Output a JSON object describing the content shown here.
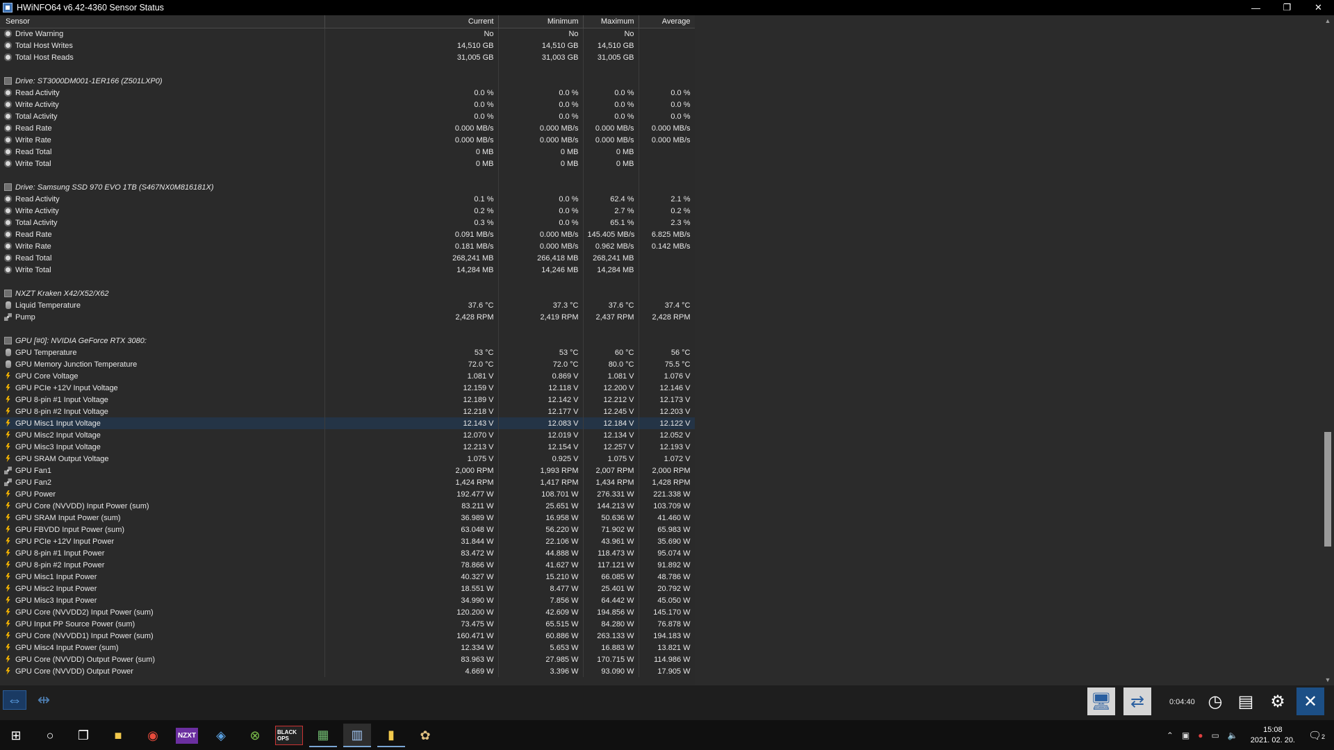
{
  "window": {
    "title": "HWiNFO64 v6.42-4360 Sensor Status",
    "min": "—",
    "restore": "❐",
    "close": "✕"
  },
  "columns": [
    "Sensor",
    "Current",
    "Minimum",
    "Maximum",
    "Average"
  ],
  "rows": [
    {
      "kind": "sensor",
      "icon": "ck",
      "name": "Drive Warning",
      "cur": "No",
      "min": "No",
      "max": "No",
      "avg": ""
    },
    {
      "kind": "sensor",
      "icon": "ck",
      "name": "Total Host Writes",
      "cur": "14,510 GB",
      "min": "14,510 GB",
      "max": "14,510 GB",
      "avg": ""
    },
    {
      "kind": "sensor",
      "icon": "ck",
      "name": "Total Host Reads",
      "cur": "31,005 GB",
      "min": "31,003 GB",
      "max": "31,005 GB",
      "avg": ""
    },
    {
      "kind": "blank"
    },
    {
      "kind": "group",
      "name": "Drive: ST3000DM001-1ER166 (Z501LXP0)"
    },
    {
      "kind": "sensor",
      "icon": "ck",
      "name": "Read Activity",
      "cur": "0.0 %",
      "min": "0.0 %",
      "max": "0.0 %",
      "avg": "0.0 %"
    },
    {
      "kind": "sensor",
      "icon": "ck",
      "name": "Write Activity",
      "cur": "0.0 %",
      "min": "0.0 %",
      "max": "0.0 %",
      "avg": "0.0 %"
    },
    {
      "kind": "sensor",
      "icon": "ck",
      "name": "Total Activity",
      "cur": "0.0 %",
      "min": "0.0 %",
      "max": "0.0 %",
      "avg": "0.0 %"
    },
    {
      "kind": "sensor",
      "icon": "ck",
      "name": "Read Rate",
      "cur": "0.000 MB/s",
      "min": "0.000 MB/s",
      "max": "0.000 MB/s",
      "avg": "0.000 MB/s"
    },
    {
      "kind": "sensor",
      "icon": "ck",
      "name": "Write Rate",
      "cur": "0.000 MB/s",
      "min": "0.000 MB/s",
      "max": "0.000 MB/s",
      "avg": "0.000 MB/s"
    },
    {
      "kind": "sensor",
      "icon": "ck",
      "name": "Read Total",
      "cur": "0 MB",
      "min": "0 MB",
      "max": "0 MB",
      "avg": ""
    },
    {
      "kind": "sensor",
      "icon": "ck",
      "name": "Write Total",
      "cur": "0 MB",
      "min": "0 MB",
      "max": "0 MB",
      "avg": ""
    },
    {
      "kind": "blank"
    },
    {
      "kind": "group",
      "name": "Drive: Samsung SSD 970 EVO 1TB (S467NX0M816181X)"
    },
    {
      "kind": "sensor",
      "icon": "ck",
      "name": "Read Activity",
      "cur": "0.1 %",
      "min": "0.0 %",
      "max": "62.4 %",
      "avg": "2.1 %"
    },
    {
      "kind": "sensor",
      "icon": "ck",
      "name": "Write Activity",
      "cur": "0.2 %",
      "min": "0.0 %",
      "max": "2.7 %",
      "avg": "0.2 %"
    },
    {
      "kind": "sensor",
      "icon": "ck",
      "name": "Total Activity",
      "cur": "0.3 %",
      "min": "0.0 %",
      "max": "65.1 %",
      "avg": "2.3 %"
    },
    {
      "kind": "sensor",
      "icon": "ck",
      "name": "Read Rate",
      "cur": "0.091 MB/s",
      "min": "0.000 MB/s",
      "max": "145.405 MB/s",
      "avg": "6.825 MB/s"
    },
    {
      "kind": "sensor",
      "icon": "ck",
      "name": "Write Rate",
      "cur": "0.181 MB/s",
      "min": "0.000 MB/s",
      "max": "0.962 MB/s",
      "avg": "0.142 MB/s"
    },
    {
      "kind": "sensor",
      "icon": "ck",
      "name": "Read Total",
      "cur": "268,241 MB",
      "min": "266,418 MB",
      "max": "268,241 MB",
      "avg": ""
    },
    {
      "kind": "sensor",
      "icon": "ck",
      "name": "Write Total",
      "cur": "14,284 MB",
      "min": "14,246 MB",
      "max": "14,284 MB",
      "avg": ""
    },
    {
      "kind": "blank"
    },
    {
      "kind": "group",
      "name": "NXZT Kraken X42/X52/X62"
    },
    {
      "kind": "sensor",
      "icon": "th",
      "name": "Liquid Temperature",
      "cur": "37.6 °C",
      "min": "37.3 °C",
      "max": "37.6 °C",
      "avg": "37.4 °C"
    },
    {
      "kind": "sensor",
      "icon": "fn",
      "name": "Pump",
      "cur": "2,428 RPM",
      "min": "2,419 RPM",
      "max": "2,437 RPM",
      "avg": "2,428 RPM"
    },
    {
      "kind": "blank"
    },
    {
      "kind": "group",
      "name": "GPU [#0]: NVIDIA GeForce RTX 3080:"
    },
    {
      "kind": "sensor",
      "icon": "th",
      "name": "GPU Temperature",
      "cur": "53 °C",
      "min": "53 °C",
      "max": "60 °C",
      "avg": "56 °C"
    },
    {
      "kind": "sensor",
      "icon": "th",
      "name": "GPU Memory Junction Temperature",
      "cur": "72.0 °C",
      "min": "72.0 °C",
      "max": "80.0 °C",
      "avg": "75.5 °C"
    },
    {
      "kind": "sensor",
      "icon": "vo",
      "name": "GPU Core Voltage",
      "cur": "1.081 V",
      "min": "0.869 V",
      "max": "1.081 V",
      "avg": "1.076 V"
    },
    {
      "kind": "sensor",
      "icon": "vo",
      "name": "GPU PCIe +12V Input Voltage",
      "cur": "12.159 V",
      "min": "12.118 V",
      "max": "12.200 V",
      "avg": "12.146 V"
    },
    {
      "kind": "sensor",
      "icon": "vo",
      "name": "GPU 8-pin #1 Input Voltage",
      "cur": "12.189 V",
      "min": "12.142 V",
      "max": "12.212 V",
      "avg": "12.173 V"
    },
    {
      "kind": "sensor",
      "icon": "vo",
      "name": "GPU 8-pin #2 Input Voltage",
      "cur": "12.218 V",
      "min": "12.177 V",
      "max": "12.245 V",
      "avg": "12.203 V"
    },
    {
      "kind": "sensor",
      "icon": "vo",
      "name": "GPU Misc1 Input Voltage",
      "cur": "12.143 V",
      "min": "12.083 V",
      "max": "12.184 V",
      "avg": "12.122 V",
      "selected": true
    },
    {
      "kind": "sensor",
      "icon": "vo",
      "name": "GPU Misc2 Input Voltage",
      "cur": "12.070 V",
      "min": "12.019 V",
      "max": "12.134 V",
      "avg": "12.052 V"
    },
    {
      "kind": "sensor",
      "icon": "vo",
      "name": "GPU Misc3 Input Voltage",
      "cur": "12.213 V",
      "min": "12.154 V",
      "max": "12.257 V",
      "avg": "12.193 V"
    },
    {
      "kind": "sensor",
      "icon": "vo",
      "name": "GPU SRAM Output Voltage",
      "cur": "1.075 V",
      "min": "0.925 V",
      "max": "1.075 V",
      "avg": "1.072 V"
    },
    {
      "kind": "sensor",
      "icon": "fn",
      "name": "GPU Fan1",
      "cur": "2,000 RPM",
      "min": "1,993 RPM",
      "max": "2,007 RPM",
      "avg": "2,000 RPM"
    },
    {
      "kind": "sensor",
      "icon": "fn",
      "name": "GPU Fan2",
      "cur": "1,424 RPM",
      "min": "1,417 RPM",
      "max": "1,434 RPM",
      "avg": "1,428 RPM"
    },
    {
      "kind": "sensor",
      "icon": "vo",
      "name": "GPU Power",
      "cur": "192.477 W",
      "min": "108.701 W",
      "max": "276.331 W",
      "avg": "221.338 W"
    },
    {
      "kind": "sensor",
      "icon": "vo",
      "name": "GPU Core (NVVDD) Input Power (sum)",
      "cur": "83.211 W",
      "min": "25.651 W",
      "max": "144.213 W",
      "avg": "103.709 W"
    },
    {
      "kind": "sensor",
      "icon": "vo",
      "name": "GPU SRAM Input Power (sum)",
      "cur": "36.989 W",
      "min": "16.958 W",
      "max": "50.636 W",
      "avg": "41.460 W"
    },
    {
      "kind": "sensor",
      "icon": "vo",
      "name": "GPU FBVDD Input Power (sum)",
      "cur": "63.048 W",
      "min": "56.220 W",
      "max": "71.902 W",
      "avg": "65.983 W"
    },
    {
      "kind": "sensor",
      "icon": "vo",
      "name": "GPU PCIe +12V Input Power",
      "cur": "31.844 W",
      "min": "22.106 W",
      "max": "43.961 W",
      "avg": "35.690 W"
    },
    {
      "kind": "sensor",
      "icon": "vo",
      "name": "GPU 8-pin #1 Input Power",
      "cur": "83.472 W",
      "min": "44.888 W",
      "max": "118.473 W",
      "avg": "95.074 W"
    },
    {
      "kind": "sensor",
      "icon": "vo",
      "name": "GPU 8-pin #2 Input Power",
      "cur": "78.866 W",
      "min": "41.627 W",
      "max": "117.121 W",
      "avg": "91.892 W"
    },
    {
      "kind": "sensor",
      "icon": "vo",
      "name": "GPU Misc1 Input Power",
      "cur": "40.327 W",
      "min": "15.210 W",
      "max": "66.085 W",
      "avg": "48.786 W"
    },
    {
      "kind": "sensor",
      "icon": "vo",
      "name": "GPU Misc2 Input Power",
      "cur": "18.551 W",
      "min": "8.477 W",
      "max": "25.401 W",
      "avg": "20.792 W"
    },
    {
      "kind": "sensor",
      "icon": "vo",
      "name": "GPU Misc3 Input Power",
      "cur": "34.990 W",
      "min": "7.856 W",
      "max": "64.442 W",
      "avg": "45.050 W"
    },
    {
      "kind": "sensor",
      "icon": "vo",
      "name": "GPU Core (NVVDD2) Input Power (sum)",
      "cur": "120.200 W",
      "min": "42.609 W",
      "max": "194.856 W",
      "avg": "145.170 W"
    },
    {
      "kind": "sensor",
      "icon": "vo",
      "name": "GPU Input PP Source Power (sum)",
      "cur": "73.475 W",
      "min": "65.515 W",
      "max": "84.280 W",
      "avg": "76.878 W"
    },
    {
      "kind": "sensor",
      "icon": "vo",
      "name": "GPU Core (NVVDD1) Input Power (sum)",
      "cur": "160.471 W",
      "min": "60.886 W",
      "max": "263.133 W",
      "avg": "194.183 W"
    },
    {
      "kind": "sensor",
      "icon": "vo",
      "name": "GPU Misc4 Input Power (sum)",
      "cur": "12.334 W",
      "min": "5.653 W",
      "max": "16.883 W",
      "avg": "13.821 W"
    },
    {
      "kind": "sensor",
      "icon": "vo",
      "name": "GPU Core (NVVDD) Output Power (sum)",
      "cur": "83.963 W",
      "min": "27.985 W",
      "max": "170.715 W",
      "avg": "114.986 W"
    },
    {
      "kind": "sensor",
      "icon": "vo",
      "name": "GPU Core (NVVDD) Output Power",
      "cur": "4.669 W",
      "min": "3.396 W",
      "max": "93.090 W",
      "avg": "17.905 W"
    }
  ],
  "toolbar": {
    "timer": "0:04:40"
  },
  "taskbar": {
    "apps": [
      "windows-start-icon",
      "cortana-icon",
      "task-view-icon",
      "file-explorer-icon",
      "chrome-icon",
      "nzxt-cam-icon",
      "app-icon",
      "xbox-icon",
      "black-ops-icon",
      "gpu-z-icon",
      "hwinfo-icon",
      "folder-icon",
      "app-icon-2"
    ],
    "time": "15:08",
    "date": "2021. 02. 20.",
    "notifications": "2"
  }
}
